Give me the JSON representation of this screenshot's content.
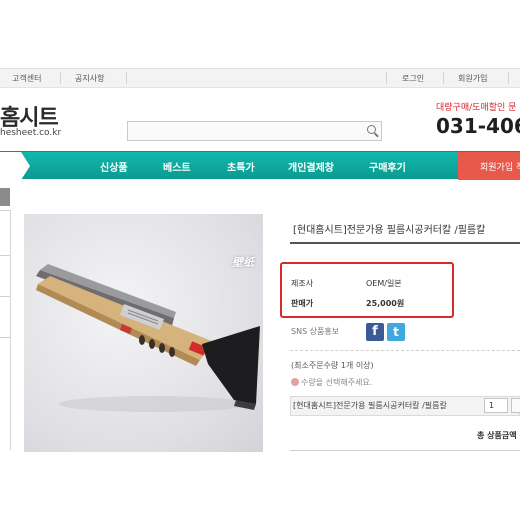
{
  "topbar": {
    "customer_center": "고객센터",
    "notice": "공지사항",
    "login": "로그인",
    "join": "회원가입"
  },
  "header": {
    "logo": "홈시트",
    "url": "hesheet.co.kr",
    "promo": "대량구매/도매할인 문",
    "phone": "031-406"
  },
  "nav": {
    "items": [
      "신상품",
      "베스트",
      "초특가",
      "개인결제창",
      "구매후기"
    ],
    "join_button": "회원가입 적"
  },
  "product": {
    "watermark": "壁纸",
    "title": "[현대홈시트]전문가용 필름시공커터칼 /필름칼",
    "maker_label": "제조사",
    "maker_value": "OEM/일본",
    "price_label": "판매가",
    "price_value": "25,000원",
    "sns_label": "SNS 상품홍보",
    "facebook": "f",
    "twitter": "t",
    "min_qty": "(최소주문수량 1개 이상)",
    "qty_note": "수량을 선택해주세요.",
    "option_name": "[현대홈시트]전문가용 필름시공커터칼 /필름칼",
    "qty_value": "1",
    "total_label": "총 상품금액"
  },
  "colors": {
    "nav": "#0fa89e",
    "join": "#e8594b",
    "highlight": "#d62a2a",
    "facebook": "#3b5b98",
    "twitter": "#41a7e0"
  }
}
